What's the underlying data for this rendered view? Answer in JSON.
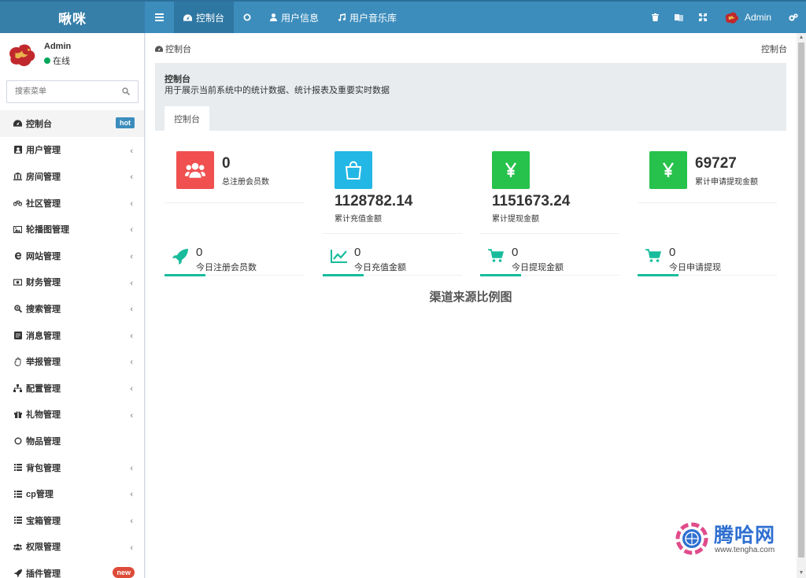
{
  "app": {
    "logo": "啾咪"
  },
  "topnav": {
    "menu_toggle": "≡",
    "tabs": [
      {
        "label": "控制台",
        "icon": "dashboard-icon",
        "active": true
      },
      {
        "label": "",
        "icon": "circle-icon",
        "active": false
      },
      {
        "label": "用户信息",
        "icon": "user-icon",
        "active": false
      },
      {
        "label": "用户音乐库",
        "icon": "music-icon",
        "active": false
      }
    ],
    "right": {
      "user_name": "Admin"
    }
  },
  "sidebar": {
    "user": {
      "name": "Admin",
      "status": "在线"
    },
    "search": {
      "placeholder": "搜索菜单"
    },
    "items": [
      {
        "label": "控制台",
        "icon": "dashboard-icon",
        "badge": "hot"
      },
      {
        "label": "用户管理",
        "icon": "user-square-icon"
      },
      {
        "label": "房间管理",
        "icon": "bank-icon"
      },
      {
        "label": "社区管理",
        "icon": "bicycle-icon"
      },
      {
        "label": "轮播图管理",
        "icon": "image-icon"
      },
      {
        "label": "网站管理",
        "icon": "ie-icon"
      },
      {
        "label": "财务管理",
        "icon": "money-icon"
      },
      {
        "label": "搜索管理",
        "icon": "search-plus-icon"
      },
      {
        "label": "消息管理",
        "icon": "message-icon"
      },
      {
        "label": "举报管理",
        "icon": "hand-icon"
      },
      {
        "label": "配置管理",
        "icon": "sitemap-icon"
      },
      {
        "label": "礼物管理",
        "icon": "gift-icon"
      },
      {
        "label": "物品管理",
        "icon": "circle-icon"
      },
      {
        "label": "背包管理",
        "icon": "list-icon"
      },
      {
        "label": "cp管理",
        "icon": "list-icon"
      },
      {
        "label": "宝箱管理",
        "icon": "list-icon"
      },
      {
        "label": "权限管理",
        "icon": "users-icon"
      },
      {
        "label": "插件管理",
        "icon": "rocket-icon",
        "badge": "new"
      }
    ]
  },
  "content": {
    "breadcrumb": "控制台",
    "breadcrumb_right": "控制台",
    "panel_title": "控制台",
    "panel_desc": "用于展示当前系统中的统计数据、统计报表及重要实时数据",
    "tab": "控制台",
    "stats": [
      {
        "value": "0",
        "label": "总注册会员数",
        "color": "#f05050",
        "icon": "users-icon"
      },
      {
        "value": "1128782.14",
        "label": "累计充值金额",
        "color": "#23b7e5",
        "icon": "shopping-bag-icon"
      },
      {
        "value": "1151673.24",
        "label": "累计提现金额",
        "color": "#27c24c",
        "icon": "yen-icon"
      },
      {
        "value": "69727",
        "label": "累计申请提现金额",
        "color": "#27c24c",
        "icon": "yen-icon"
      }
    ],
    "today": [
      {
        "value": "0",
        "label": "今日注册会员数",
        "icon": "rocket-icon"
      },
      {
        "value": "0",
        "label": "今日充值金额",
        "icon": "line-chart-icon"
      },
      {
        "value": "0",
        "label": "今日提现金额",
        "icon": "cart-icon"
      },
      {
        "value": "0",
        "label": "今日申请提现",
        "icon": "cart-icon"
      }
    ],
    "chart_title": "渠道来源比例图",
    "accent": "#18bc9c"
  },
  "watermark": {
    "brand": "腾哈网",
    "url": "www.tengha.com"
  }
}
